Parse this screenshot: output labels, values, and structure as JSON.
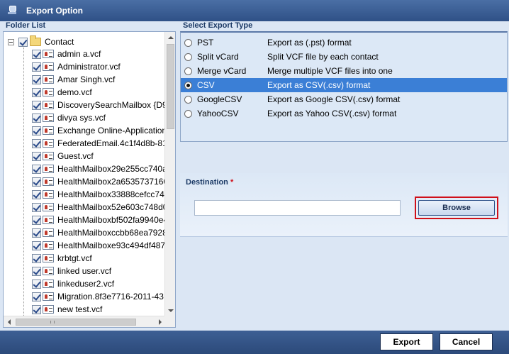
{
  "window": {
    "title": "Export Option",
    "icon": "app-icon"
  },
  "folder_list": {
    "label": "Folder List",
    "root": {
      "label": "Contact",
      "expander": "collapse",
      "checked": true,
      "icon": "folder-icon"
    },
    "items": [
      {
        "label": "admin a.vcf",
        "checked": true
      },
      {
        "label": "Administrator.vcf",
        "checked": true
      },
      {
        "label": "Amar Singh.vcf",
        "checked": true
      },
      {
        "label": "demo.vcf",
        "checked": true
      },
      {
        "label": "DiscoverySearchMailbox {D9",
        "checked": true
      },
      {
        "label": "divya sys.vcf",
        "checked": true
      },
      {
        "label": "Exchange Online-Application",
        "checked": true
      },
      {
        "label": "FederatedEmail.4c1f4d8b-81",
        "checked": true
      },
      {
        "label": "Guest.vcf",
        "checked": true
      },
      {
        "label": "HealthMailbox29e255cc740a",
        "checked": true
      },
      {
        "label": "HealthMailbox2a6535737160",
        "checked": true
      },
      {
        "label": "HealthMailbox33888cefcc744",
        "checked": true
      },
      {
        "label": "HealthMailbox52e603c748d0",
        "checked": true
      },
      {
        "label": "HealthMailboxbf502fa9940e4",
        "checked": true
      },
      {
        "label": "HealthMailboxccbb68ea7928",
        "checked": true
      },
      {
        "label": "HealthMailboxe93c494df4874",
        "checked": true
      },
      {
        "label": "krbtgt.vcf",
        "checked": true
      },
      {
        "label": "linked user.vcf",
        "checked": true
      },
      {
        "label": "linkeduser2.vcf",
        "checked": true
      },
      {
        "label": "Migration.8f3e7716-2011-43",
        "checked": true
      },
      {
        "label": "new test.vcf",
        "checked": true
      }
    ]
  },
  "export_type": {
    "label": "Select Export Type",
    "selected": "CSV",
    "options": [
      {
        "name": "PST",
        "description": "Export as (.pst) format"
      },
      {
        "name": "Split vCard",
        "description": "Split VCF file by each contact"
      },
      {
        "name": "Merge vCard",
        "description": "Merge multiple VCF files into one"
      },
      {
        "name": "CSV",
        "description": "Export as CSV(.csv) format"
      },
      {
        "name": "GoogleCSV",
        "description": "Export as Google CSV(.csv) format"
      },
      {
        "name": "YahooCSV",
        "description": "Export as Yahoo CSV(.csv) format"
      }
    ]
  },
  "destination": {
    "label": "Destination",
    "required_marker": "*",
    "value": "",
    "browse_label": "Browse",
    "highlight_color": "#d0101a"
  },
  "footer": {
    "export_label": "Export",
    "cancel_label": "Cancel"
  },
  "colors": {
    "titlebar": "#2f5187",
    "selection": "#3b7fd6",
    "panel": "#dce8f6"
  }
}
